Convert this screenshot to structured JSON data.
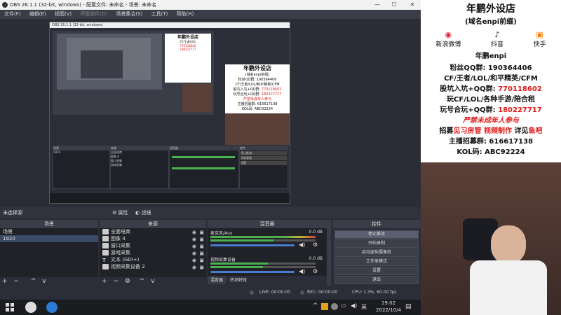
{
  "window": {
    "title": "OBS 26.1.1 (32-bit, windows) - 配置文件: 未命名 - 场景: 未命名"
  },
  "menu": [
    "文件(F)",
    "编辑(E)",
    "视图(V)",
    "停靠部件(D)",
    "场景集合(S)",
    "工具(T)",
    "帮助(H)"
  ],
  "overlay": {
    "heading": "年鹏外设店",
    "subheading": "(域名enpi前缀)",
    "socials": [
      {
        "label": "新浪微博",
        "icon": "weibo-icon"
      },
      {
        "label": "抖音",
        "icon": "douyin-icon"
      },
      {
        "label": "快手",
        "icon": "kuaishou-icon"
      }
    ],
    "handle": "年鹏enpi",
    "fans_qq": "粉丝QQ群: 190364406",
    "games": "CF/王者/LOL/和平精英/CFM",
    "fans_group": "股坑入坑+QQ群: ",
    "fans_group_num": "770118602",
    "play_group": "玩CF/LOL/各种手游/陪合租",
    "trade_group": "玩号合玩+QQ群: ",
    "trade_group_num": "180227717",
    "no_minors": "严禁未成年人参与",
    "recruit_prefix": "招募",
    "recruit_mid1": "见习房管",
    "recruit_mid2": "视频制作",
    "recruit_mid3": "详见",
    "recruit_tail": "鱼吧",
    "host_recruit": "主播招募群: 616617138",
    "kol": "KOL码: ABC92224"
  },
  "source_bar": {
    "label": "未选择源",
    "properties": "属性",
    "filters": "滤镜"
  },
  "docks": {
    "scenes": {
      "title": "场景",
      "items": [
        "场景",
        "1920"
      ]
    },
    "sources": {
      "title": "来源",
      "items": [
        "全面电商",
        "图像 4",
        "窗口采集",
        "游戏采集",
        "文本 (GDI+)",
        "视频采集设备 2"
      ]
    },
    "mixer": {
      "title": "混音器",
      "tracks": [
        {
          "name": "麦克风/Aux",
          "db": "0.0 dB"
        },
        {
          "name": "视频采集设备",
          "db": "0.0 dB"
        }
      ],
      "tabs": [
        "混音器",
        "转场特效"
      ]
    },
    "controls": {
      "title": "控件",
      "buttons": [
        "停止推流",
        "开始录制",
        "启动虚拟摄像机",
        "工作室模式",
        "设置",
        "退出"
      ]
    }
  },
  "status": {
    "live": "LIVE: 00:00:00",
    "rec": "REC: 00:00:00",
    "cpu": "CPU: 1.3%, 60.00 fps"
  },
  "taskbar": {
    "time": "19:02",
    "date": "2022/10/4",
    "lang": "英"
  },
  "colors": {
    "accent_red": "#e01b1b",
    "obs_bg": "#2b2e38",
    "meter_green": "#4caf50"
  }
}
